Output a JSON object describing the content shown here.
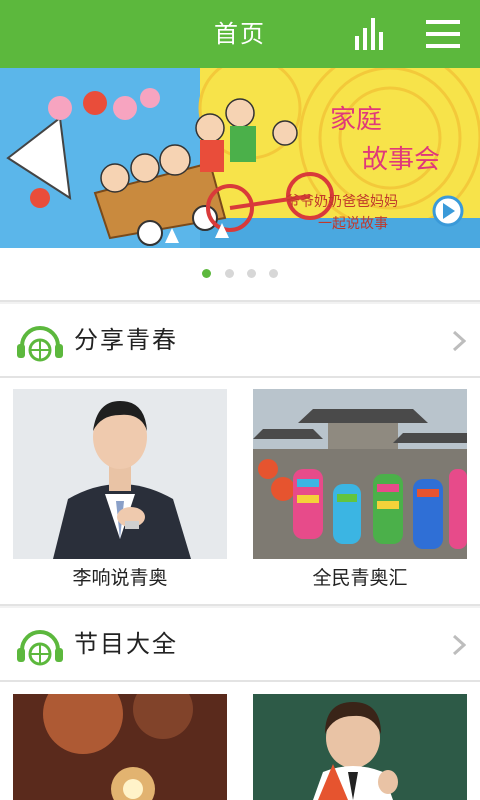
{
  "header": {
    "title": "首页",
    "chart_icon": "bar-chart-icon",
    "menu_icon": "hamburger-menu-icon"
  },
  "banner": {
    "headline": "家庭故事会",
    "tagline_line1": "爷爷奶奶爸爸妈妈",
    "tagline_line2": "一起说故事",
    "page_count": 4,
    "active_page": 1
  },
  "sections": [
    {
      "title": "分享青春",
      "icon": "headphones-icon",
      "items": [
        {
          "caption": "李响说青奥"
        },
        {
          "caption": "全民青奥汇"
        }
      ]
    },
    {
      "title": "节目大全",
      "icon": "headphones-icon",
      "items": [
        {
          "caption": ""
        },
        {
          "caption": ""
        }
      ]
    }
  ],
  "colors": {
    "brand_green": "#5cb83d",
    "page_bg": "#f2f2f2"
  }
}
